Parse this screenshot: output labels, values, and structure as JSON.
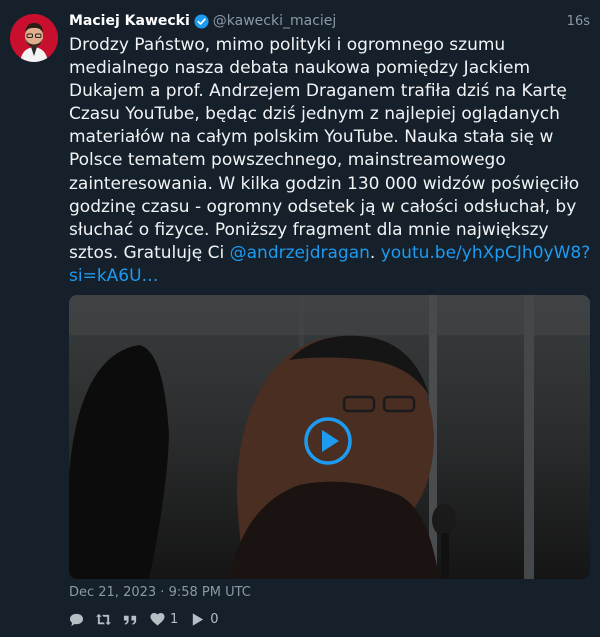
{
  "author": {
    "name": "Maciej Kawecki",
    "handle": "@kawecki_maciej",
    "time_ago": "16s"
  },
  "tweet": {
    "text_main": "Drodzy Państwo, mimo polityki i ogromnego szumu medialnego nasza debata naukowa pomiędzy Jackiem Dukajem a prof. Andrzejem Draganem trafiła dziś na Kartę Czasu YouTube, będąc dziś jednym z najlepiej oglądanych materiałów na całym polskim YouTube. Nauka stała się w Polsce tematem powszechnego, mainstreamowego zainteresowania. W kilka godzin 130 000 widzów poświęciło godzinę czasu - ogromny odsetek ją w całości odsłuchał, by słuchać o fizyce. Poniższy fragment dla mnie największy sztos. Gratuluję Ci ",
    "mention": "@andrzejdragan",
    "separator": ".",
    "url": "youtu.be/yhXpCJh0yW8?si=kA6U…"
  },
  "meta": {
    "timestamp": "Dec 21, 2023 · 9:58 PM UTC"
  },
  "actions": {
    "likes": "1",
    "views": "0"
  },
  "icons": {
    "avatar": "profile-photo",
    "verified": "verified-badge-icon",
    "play": "play-icon",
    "reply": "reply-icon",
    "retweet": "retweet-icon",
    "quote": "quote-icon",
    "like": "heart-icon",
    "views": "play-views-icon"
  },
  "colors": {
    "background": "#15202b",
    "link": "#1d9bf0",
    "muted": "#8b98a5"
  }
}
